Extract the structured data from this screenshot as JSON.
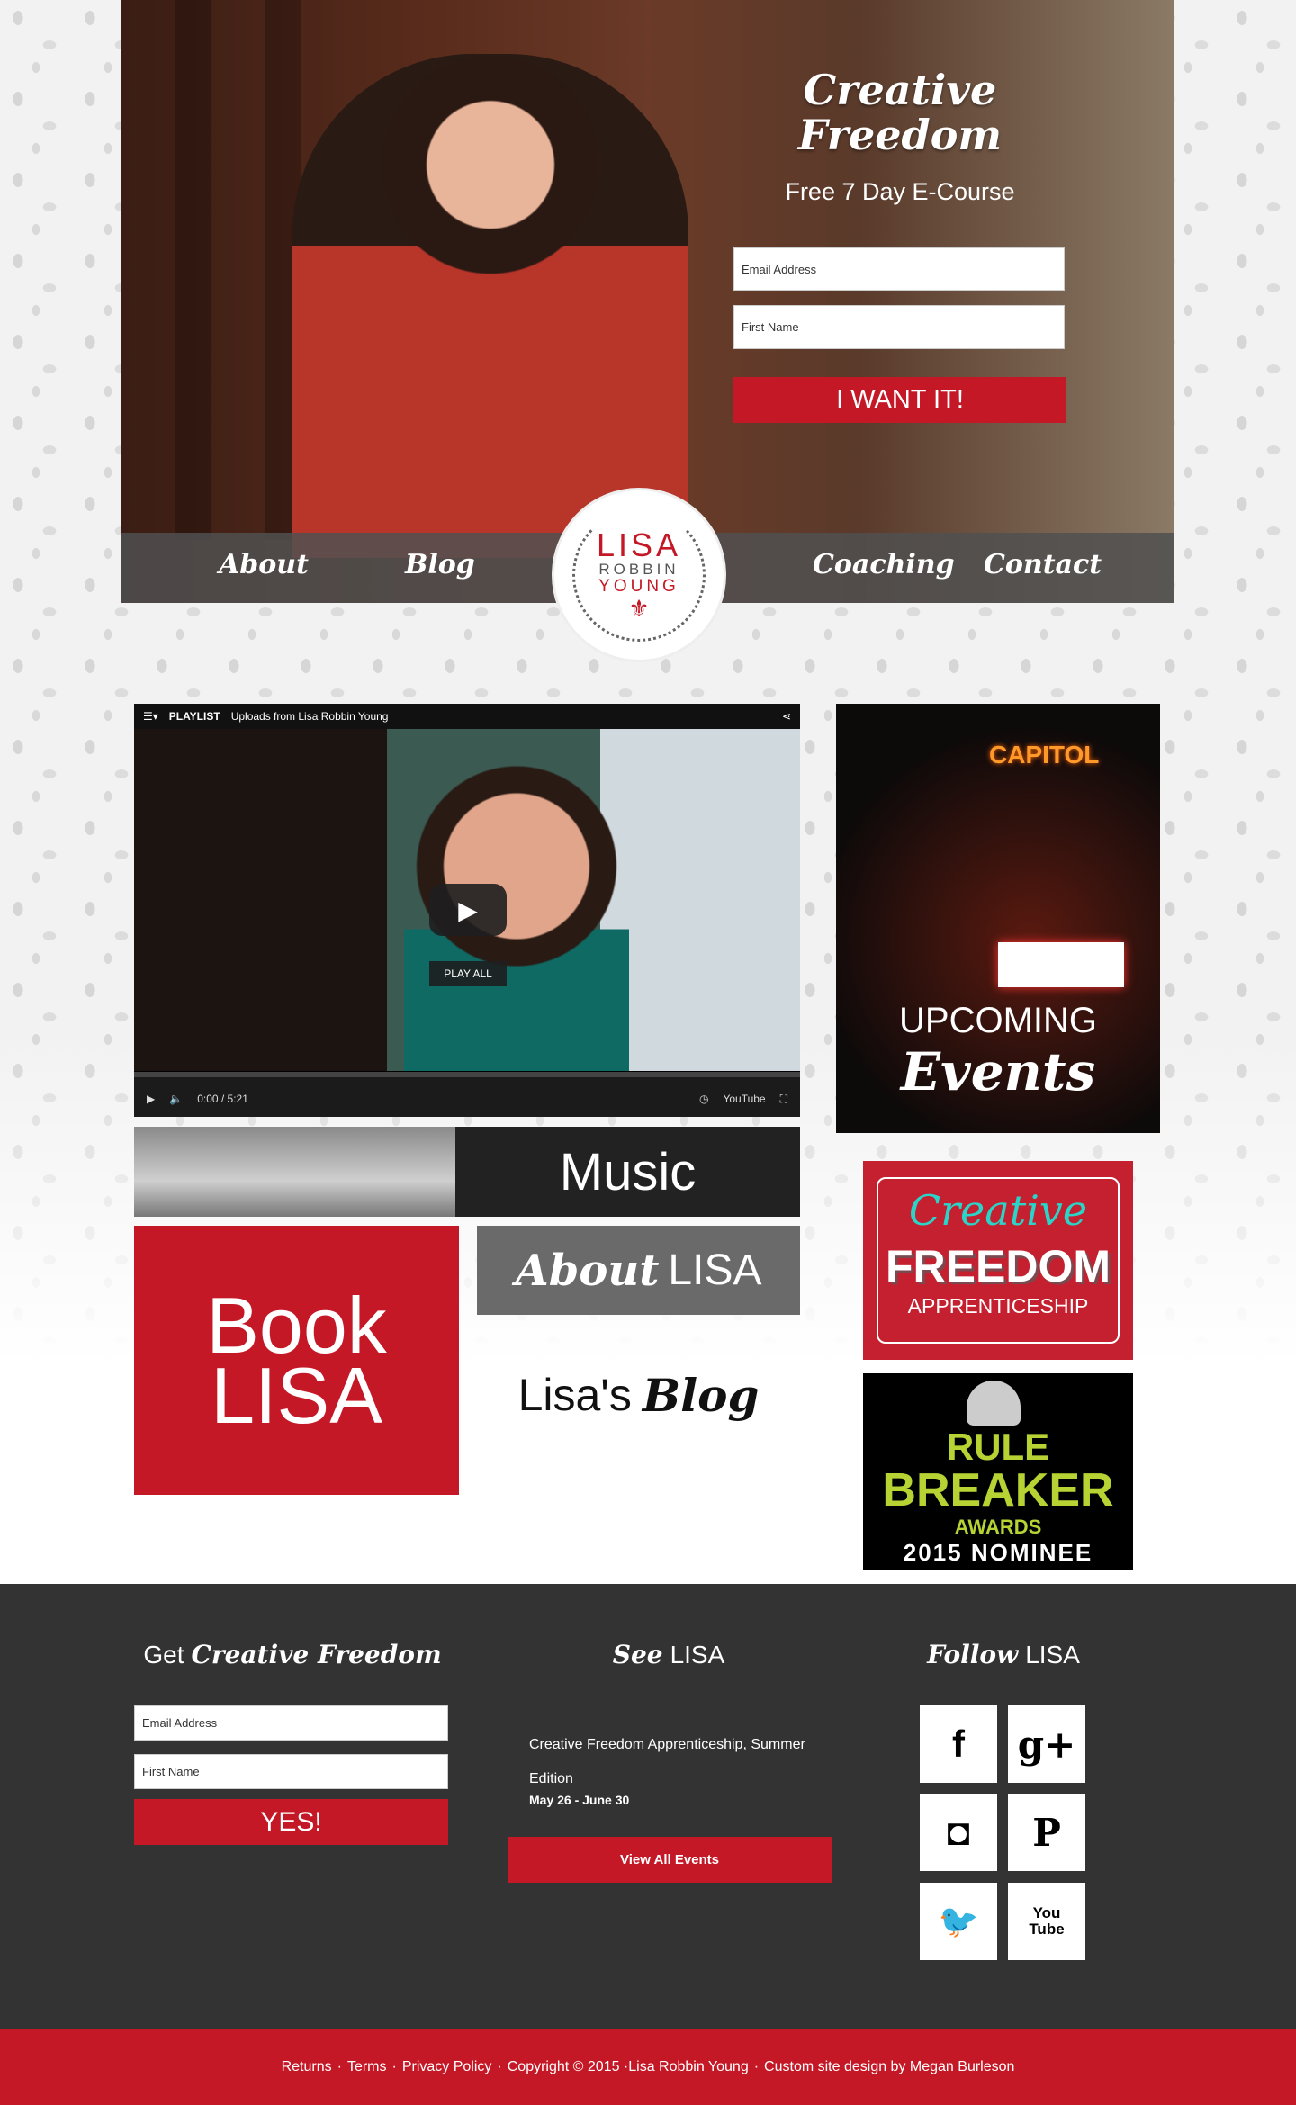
{
  "hero": {
    "title_line1": "Creative",
    "title_line2": "Freedom",
    "subtitle": "Free 7 Day E-Course",
    "email_placeholder": "Email Address",
    "name_placeholder": "First Name",
    "submit_label": "I WANT IT!"
  },
  "nav": {
    "items": [
      "About",
      "Blog",
      "Coaching",
      "Contact"
    ],
    "logo": {
      "line1": "LISA",
      "line2": "ROBBIN",
      "line3": "YOUNG"
    }
  },
  "video": {
    "playlist_label": "PLAYLIST",
    "title": "Uploads from Lisa Robbin Young",
    "play_all": "PLAY ALL",
    "time": "0:00 / 5:21",
    "youtube": "YouTube"
  },
  "tiles": {
    "events": {
      "capitol": "CAPITOL",
      "line1": "UPCOMING",
      "line2": "Events"
    },
    "music": "Music",
    "book": {
      "line1": "Book",
      "line2": "LISA"
    },
    "about": {
      "script": "About",
      "plain": "LISA"
    },
    "blog": {
      "plain": "Lisa's",
      "script": "Blog"
    },
    "creative_freedom": {
      "line1": "Creative",
      "line2": "FREEDOM",
      "line3": "APPRENTICESHIP"
    },
    "rule_breaker": {
      "line1": "RULE",
      "line2": "BREAKER",
      "line3": "AWARDS",
      "line4": "2015 NOMINEE"
    }
  },
  "footer": {
    "col1": {
      "prefix": "Get",
      "script": "Creative Freedom",
      "email_placeholder": "Email Address",
      "name_placeholder": "First Name",
      "submit_label": "YES!"
    },
    "col2": {
      "script": "See",
      "plain": "LISA",
      "event_title": "Creative Freedom Apprenticeship, Summer Edition",
      "event_date": "May 26 - June 30",
      "button_label": "View All Events"
    },
    "col3": {
      "script": "Follow",
      "plain": "LISA",
      "social": [
        "f",
        "g+",
        "◘",
        "P",
        "🐦",
        "You Tube"
      ]
    }
  },
  "bottom_bar": {
    "links": [
      "Returns",
      "Terms",
      "Privacy Policy",
      "Copyright © 2015 ·Lisa Robbin Young",
      "Custom site design by Megan Burleson"
    ],
    "separator": "·"
  },
  "colors": {
    "brand_red": "#c41826",
    "footer_dark": "#333333",
    "teal": "#2ad4c8",
    "lime": "#b6d233"
  }
}
